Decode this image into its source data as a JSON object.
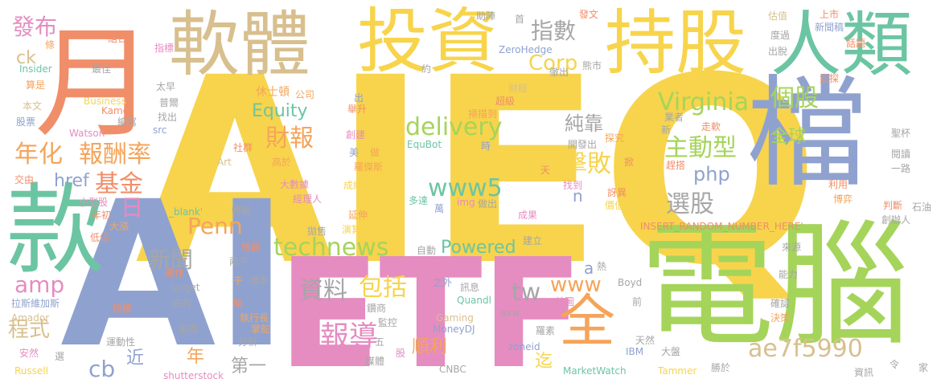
{
  "colors": {
    "yellow": "#f7d44c",
    "green": "#a5d45a",
    "blue": "#8fa2cf",
    "pink": "#e58cc1",
    "orange": "#f5a45a",
    "tan": "#d8bf8e",
    "teal": "#6cc5a2",
    "gray": "#a6a6a6",
    "salmon": "#f08e6a"
  },
  "words": {
    "aieq": "AIEQ",
    "ai": "AI",
    "etf": "ETF",
    "dian_nao": "電腦",
    "dang": "檔",
    "kuan": "款",
    "yue": "月",
    "ruan_ti": "軟體",
    "tou_zi": "投資",
    "chi_gu": "持股",
    "ren_lei": "人類",
    "quan": "全",
    "bao_dao": "報導",
    "zi_liao": "資料",
    "bao_kuo": "包括",
    "nian_hua": "年化",
    "bao_chou_lv": "報酬率",
    "ji_jin": "基金",
    "ri": "日",
    "fa_bu": "發布",
    "ck": "ck",
    "zhi_shu": "指數",
    "corp": "Corp",
    "virginia": "Virginia",
    "ge_gu": "個股",
    "zhu_dong_xing": "主動型",
    "quan_qiu": "全球",
    "ji_bai": "擊敗",
    "php": "php",
    "www5": "www5",
    "delivery": "delivery",
    "chun_kao": "純靠",
    "cai_bao": "財報",
    "equity": "Equity",
    "penn": "Penn",
    "technews": "technews",
    "href": "href",
    "xin_wen": "新聞",
    "amp": "amp",
    "cheng_shi": "程式",
    "cb": "cb",
    "jin": "近",
    "nian": "年",
    "xuan_gu": "選股",
    "powered": "Powered",
    "tw": "tw",
    "www": "www",
    "ae7f5990": "ae7f5990",
    "shun_li": "順利",
    "di_yi": "第一",
    "qi": "迄",
    "a": "a",
    "n": "n",
    "cheng": "成",
    "cheng_ji_dan": "成績單",
    "da_shu_ju": "大數據",
    "jing_li_ren": "經理人",
    "yan_suan_fa": "演算法",
    "yan_shen": "延伸",
    "kao": "高於",
    "she_qun": "社群",
    "art": "Art",
    "xiu_shi_dun": "休士頓",
    "gong_si": "公司",
    "ju_sheng": "舉升",
    "chuang_jian": "創建",
    "luo_ji_si": "羅傑斯",
    "mei": "美",
    "zuo": "做",
    "kai_fa_chu": "開發出",
    "shi": "時",
    "tan_jiu": "探究",
    "lian": "掀",
    "zhao_dao": "找到",
    "qi_yi": "訝異",
    "jia_zhi": "價值",
    "cheng_guo": "成果",
    "duo_da": "多達",
    "wan": "萬",
    "img": "img",
    "zuo_chu": "做出",
    "equbot": "EquBot",
    "sao_miao_dao": "掃描到",
    "chao_ji": "超級",
    "cai_jing": "財經",
    "zhu_zhen": "助陣",
    "shou": "首",
    "fa_wen": "發文",
    "gu_zhi": "估值",
    "shang_shi": "上市",
    "xin_wen_gao": "新聞稿",
    "hua_ti": "話題",
    "du_guo": "度過",
    "chu_gu": "出脫",
    "qi_tan": "氣探",
    "xiong_shi": "熊市",
    "che_chu": "徹出",
    "zerohedge": "ZeroHedge",
    "yue2": "約",
    "tiao": "條",
    "zu_he": "組合",
    "zhi_biao": "指標",
    "zui_jia": "最佳",
    "insider": "Insider",
    "suan_shi": "算是",
    "ben_wen": "本文",
    "gu_piao": "股票",
    "business": "Business",
    "kamel": "Kamel",
    "watson": "Watson",
    "bian_xie": "編寫",
    "src": "src",
    "zhao_chu": "找出",
    "pu_er": "普爾",
    "tai_zao": "太早",
    "jiao_you": "交由",
    "chu": "出",
    "tian": "天",
    "xiao_xing_gu": "小型股",
    "nian_chu": "年初",
    "da_zhang": "大漲",
    "di_gu": "低估",
    "blank": "_blank'",
    "zhuan_zai": "轉載",
    "pao_shou": "拋售",
    "ji_qi": "機器",
    "liang_qian": "兩千",
    "biao_zhun": "標準",
    "qian": "千",
    "yun_zuo": "運作",
    "target": "target",
    "la_si_wei_jia_si": "拉斯維加斯",
    "zai_nei": "在內",
    "lue": "略",
    "amador": "Amador",
    "shou_quan": "授權",
    "zhi_de": "值得",
    "zhi_xing_zhang": "執行長",
    "zhang_duo": "掌舵",
    "fen_xi": "分析",
    "yun_dong_xing": "運動性",
    "an_ran": "安然",
    "xuan": "選",
    "russell": "Russell",
    "shutterstock": "shutterstock",
    "mei_ti": "媒體",
    "gu": "股",
    "wu": "五",
    "jian_kong": "監控",
    "suo_shang": "鑽商",
    "zi_dong": "自動",
    "zhi_wai": "之外",
    "xun_xi": "訊息",
    "quandl": "Quandl",
    "gaming": "Gaming",
    "moneydj": "MoneyDJ",
    "zoneid": "zoneid",
    "avw": "avw",
    "cnbc": "CNBC",
    "luo_su": "羅素",
    "ibm": "IBM",
    "tian_ran": "天然",
    "da_pan": "大盤",
    "marketwatch": "MarketWatch",
    "tammer": "Tammer",
    "sheng_yu": "勝於",
    "jian_li": "建立",
    "insert": "INSERT",
    "insert_random": "INSERT_RANDOM_NUMBER_HERE'",
    "re": "熱",
    "shou_tu": "首圖",
    "boyd": "Boyd",
    "qian2": "前",
    "jue_ce": "決策",
    "que_ren": "確認",
    "neng_li": "能力",
    "lai_yuan": "來源",
    "chuang_ban_ren": "創辦人",
    "pan_duan": "判斷",
    "shi_you": "石油",
    "bo_yi": "博弈",
    "li_yong": "利用",
    "yi_lu": "一路",
    "yue_du": "閱讀",
    "sheng_bei": "聖杯",
    "zou_ruan": "走軟",
    "ye_zhe": "業者",
    "xin": "新",
    "gan_chao": "趕搭",
    "ling": "令",
    "jia": "家",
    "zi_xun": "資訊"
  }
}
